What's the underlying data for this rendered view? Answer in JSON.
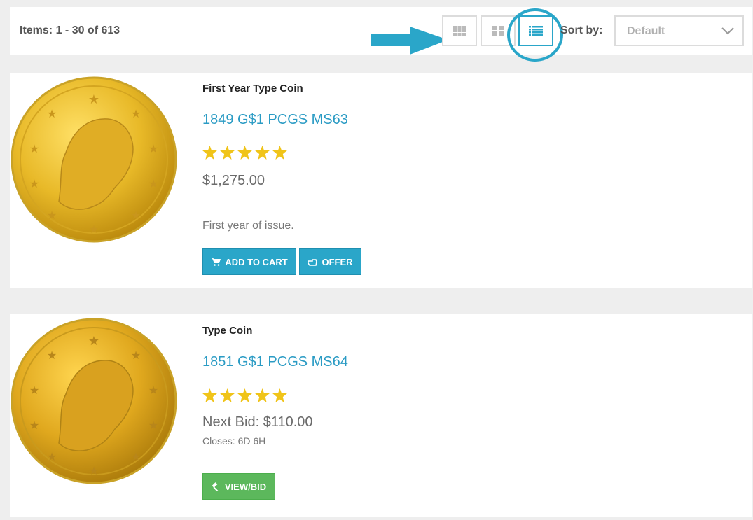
{
  "toolbar": {
    "items_count": "Items: 1 - 30 of 613",
    "sort_label": "Sort by:",
    "sort_value": "Default",
    "accent": "#2aa6c9"
  },
  "products": [
    {
      "category": "First Year Type Coin",
      "title": "1849 G$1 PCGS MS63",
      "rating": 5,
      "price": "$1,275.00",
      "description": "First year of issue.",
      "buttons": [
        "ADD TO CART",
        "OFFER"
      ]
    },
    {
      "category": "Type Coin",
      "title": "1851 G$1 PCGS MS64",
      "rating": 5,
      "price": "Next Bid: $110.00",
      "closes": "Closes: 6D 6H",
      "buttons": [
        "VIEW/BID"
      ]
    }
  ],
  "colors": {
    "link": "#2a9bc4",
    "star": "#f0c419",
    "button_blue": "#2aa6c9",
    "button_green": "#5cb85c"
  }
}
